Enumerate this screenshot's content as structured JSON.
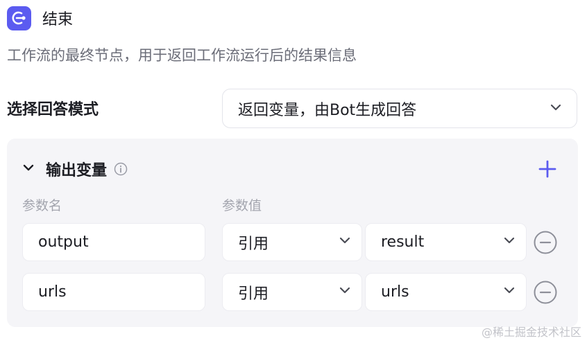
{
  "node": {
    "icon": "end-node-icon",
    "title": "结束",
    "description": "工作流的最终节点，用于返回工作流运行后的结果信息"
  },
  "answer_mode": {
    "label": "选择回答模式",
    "selected": "返回变量，由Bot生成回答"
  },
  "output_vars": {
    "title": "输出变量",
    "col_name": "参数名",
    "col_value": "参数值",
    "rows": [
      {
        "name": "output",
        "type": "引用",
        "value": "result"
      },
      {
        "name": "urls",
        "type": "引用",
        "value": "urls"
      }
    ]
  },
  "colors": {
    "accent": "#5b5bf0",
    "panel_bg": "#f5f5f8",
    "muted": "#a3a5ae"
  },
  "watermark": "@稀土掘金技术社区"
}
